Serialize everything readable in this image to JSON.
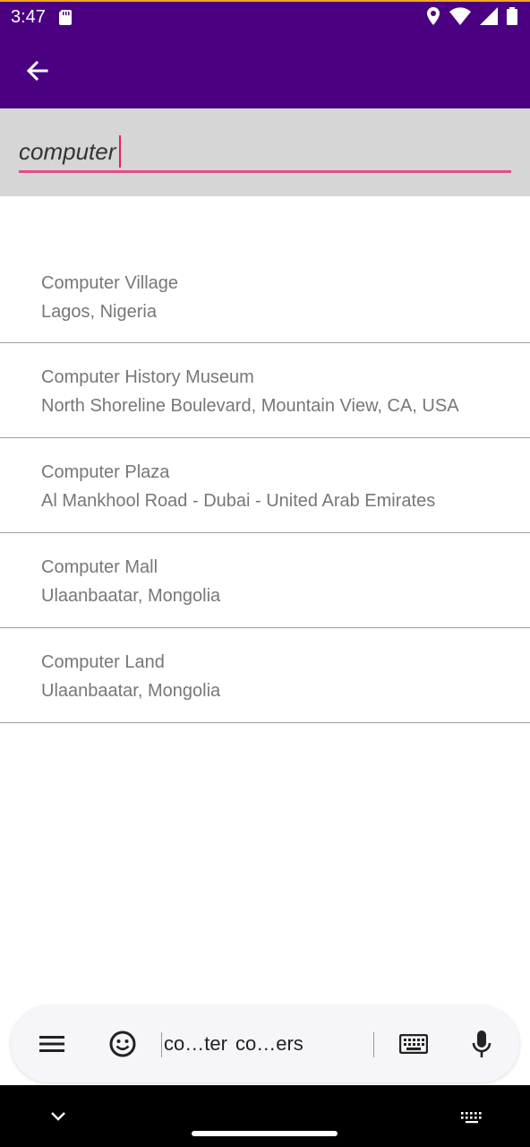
{
  "status_bar": {
    "time": "3:47"
  },
  "search": {
    "value": "computer"
  },
  "results": [
    {
      "name": "Computer Village",
      "address": "Lagos, Nigeria"
    },
    {
      "name": "Computer History Museum",
      "address": "North Shoreline Boulevard, Mountain View, CA, USA"
    },
    {
      "name": "Computer Plaza",
      "address": "Al Mankhool Road - Dubai - United Arab Emirates"
    },
    {
      "name": "Computer Mall",
      "address": "Ulaanbaatar, Mongolia"
    },
    {
      "name": "Computer Land",
      "address": "Ulaanbaatar, Mongolia"
    }
  ],
  "keyboard": {
    "suggestions": [
      "co…ter",
      "co…ers"
    ]
  },
  "colors": {
    "app_bar": "#4b0082",
    "accent": "#e64b8c"
  }
}
